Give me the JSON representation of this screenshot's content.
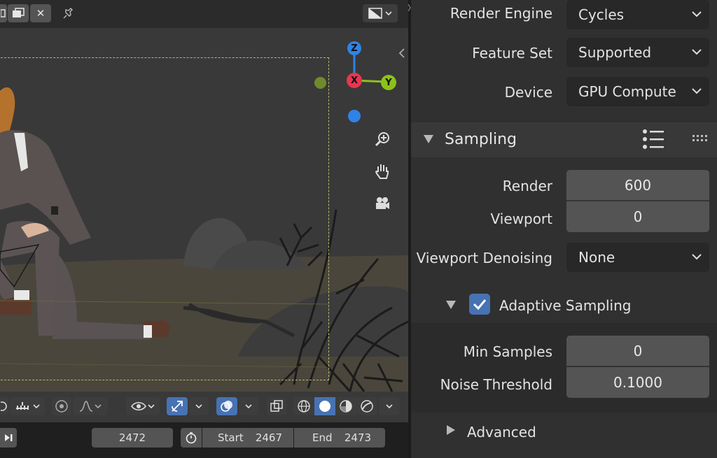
{
  "viewport": {
    "header": {
      "close_glyph": "✕"
    },
    "timeline": {
      "current_frame": "2472",
      "start_label": "Start",
      "start_value": "2467",
      "end_label": "End",
      "end_value": "2473"
    },
    "gizmo": {
      "z": "Z",
      "x": "X",
      "y": "Y"
    }
  },
  "properties": {
    "render_engine": {
      "label": "Render Engine",
      "value": "Cycles"
    },
    "feature_set": {
      "label": "Feature Set",
      "value": "Supported"
    },
    "device": {
      "label": "Device",
      "value": "GPU Compute"
    },
    "sampling": {
      "title": "Sampling",
      "render_label": "Render",
      "render_value": "600",
      "viewport_label": "Viewport",
      "viewport_value": "0",
      "denoising_label": "Viewport Denoising",
      "denoising_value": "None",
      "adaptive": {
        "label": "Adaptive Sampling",
        "checked": true,
        "min_samples_label": "Min Samples",
        "min_samples_value": "0",
        "noise_threshold_label": "Noise Threshold",
        "noise_threshold_value": "0.1000"
      },
      "advanced_label": "Advanced"
    }
  },
  "colors": {
    "accent_blue": "#4772b3",
    "axis_x": "#e8364f",
    "axis_y": "#8bc21a",
    "axis_z": "#2f83e6"
  }
}
